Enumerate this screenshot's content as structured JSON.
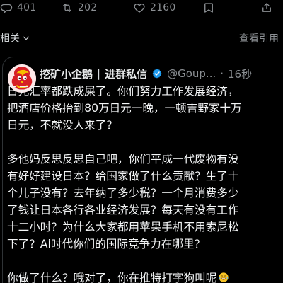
{
  "actions": {
    "reply_count": "401",
    "retweet_count": "202",
    "like_count": "2160"
  },
  "subbar": {
    "left_label": "相关",
    "right_label": "查看引用"
  },
  "quote": {
    "display_name": "挖矿小企鹅",
    "separator": "|",
    "name_suffix": "进群私信",
    "handle": "@Goup...",
    "dot": "·",
    "time": "16秒",
    "body": "日元汇率都跌成屎了。你们努力工作发展经济，\n把酒店价格抬到80万日元一晚，一顿吉野家十万\n日元，不就没人来了？\n\n多他妈反思反思自己吧，你们平成一代废物有没\n有好好建设日本？给国家做了什么贡献？生了十\n个儿子没有？去年纳了多少税？一个月消费多少\n了钱让日本各行各业经济发展？每天有没有工作\n十二小时？为什么大家都用苹果手机不用索尼松\n下了？Ai时代你们的国际竞争力在哪里？\n\n你做了什么？哦对了，你在推特打字狗叫呢"
  },
  "icons": {
    "reply": "reply-icon",
    "retweet": "retweet-icon",
    "like": "like-icon",
    "bookmark": "bookmark-icon",
    "share": "share-icon",
    "verified": "verified-badge-icon",
    "emoji": "laughing-emoji-icon"
  },
  "colors": {
    "background": "#000000",
    "muted": "#8b8f93",
    "text": "#e7e9ea",
    "border": "#2f3336",
    "verified": "#1d9bf0",
    "avatar_red": "#d61f26",
    "avatar_yellow": "#f6c000"
  }
}
